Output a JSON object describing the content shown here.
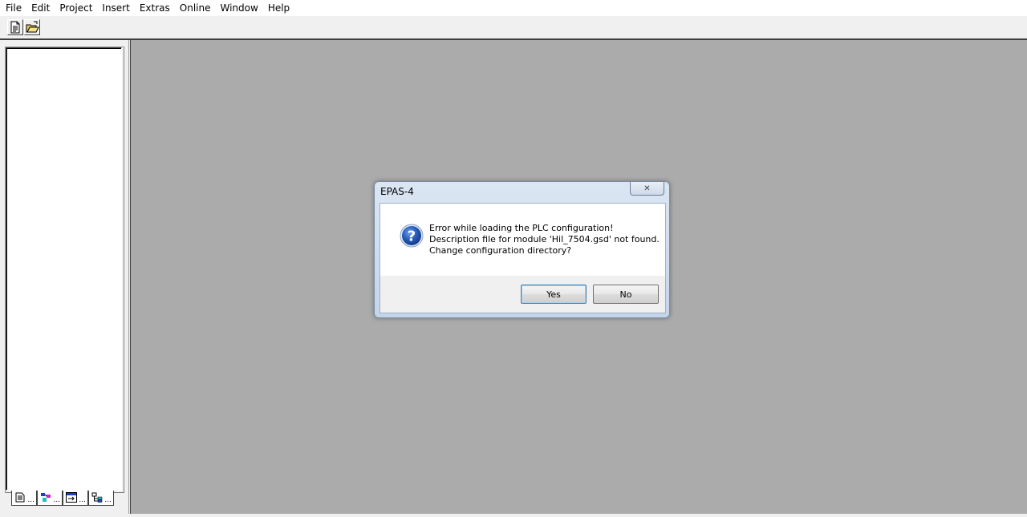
{
  "menu": {
    "items": [
      "File",
      "Edit",
      "Project",
      "Insert",
      "Extras",
      "Online",
      "Window",
      "Help"
    ]
  },
  "toolbar": {
    "buttons": [
      {
        "icon": "new-document-icon"
      },
      {
        "icon": "open-folder-icon"
      }
    ]
  },
  "object_tabs": [
    {
      "icon": "pou-icon",
      "label": "..."
    },
    {
      "icon": "data-types-icon",
      "label": "..."
    },
    {
      "icon": "visualizations-icon",
      "label": "..."
    },
    {
      "icon": "resources-icon",
      "label": "..."
    }
  ],
  "dialog": {
    "title": "EPAS-4",
    "close_glyph": "✕",
    "message_line1": "Error while loading the PLC configuration!",
    "message_line2": "Description file for module 'Hil_7504.gsd' not found.",
    "message_line3": "Change configuration directory?",
    "yes_label": "Yes",
    "no_label": "No",
    "icon": "question-icon"
  },
  "colors": {
    "mdi_background": "#ababab",
    "dialog_frame": "#c4d5ea",
    "question_blue": "#1f4fa8"
  }
}
